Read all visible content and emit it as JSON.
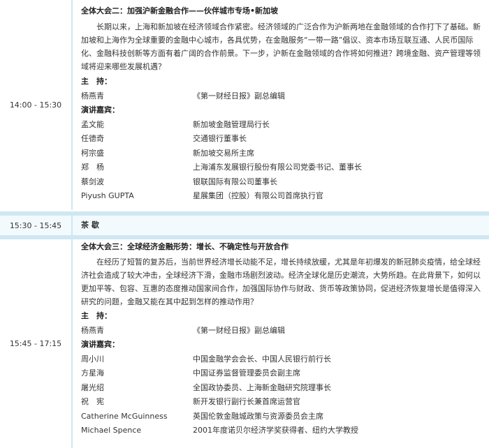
{
  "session2": {
    "time": "14:00 - 15:30",
    "title": "全体大会二：加强沪新金融合作——伙伴城市专场•新加坡",
    "intro": "长期以来，上海和新加坡在经济领域合作紧密。经济领域的广泛合作为沪新两地在金融领域的合作打下了基础。新加坡和上海作为全球重要的金融中心城市，各具优势，在金融服务“一带一路”倡议、资本市场互联互通、人民币国际化、金融科技创新等方面有着广阔的合作前景。下一步，沪新在金融领域的合作将如何推进？跨境金融、资产管理等领域将迎来哪些发展机遇？",
    "host_label": "主　持：",
    "host": {
      "name": "杨燕青",
      "role": "《第一财经日报》副总编辑"
    },
    "speakers_label": "演讲嘉宾：",
    "speakers": [
      {
        "name": "孟文能",
        "role": "新加坡金融管理局行长"
      },
      {
        "name": "任德奇",
        "role": "交通银行董事长"
      },
      {
        "name": "柯宗盛",
        "role": "新加坡交易所主席"
      },
      {
        "name": "郑　杨",
        "role": "上海浦东发展银行股份有限公司党委书记、董事长"
      },
      {
        "name": "蔡剑波",
        "role": "银联国际有限公司董事长"
      },
      {
        "name": "Piyush GUPTA",
        "role": "星展集团（控股）有限公司首席执行官"
      }
    ]
  },
  "break": {
    "time": "15:30 - 15:45",
    "label": "茶 歇"
  },
  "session3": {
    "time": "15:45 - 17:15",
    "title": "全体大会三：全球经济金融形势：增长、不确定性与开放合作",
    "intro": "在经历了短暂的复苏后，当前世界经济增长动能不足，增长持续放缓，尤其是年初爆发的新冠肺炎疫情，给全球经济社会造成了较大冲击，全球经济下滑，金融市场剧烈波动。经济全球化是历史潮流，大势所趋。在此背景下，如何以更加平等、包容、互惠的态度推动国家间合作，加强国际协作与财政、货币等政策协同，促进经济恢复增长是值得深入研究的问题，金融又能在其中起到怎样的推动作用？",
    "host_label": "主　持：",
    "host": {
      "name": "杨燕青",
      "role": "《第一财经日报》副总编辑"
    },
    "speakers_label": "演讲嘉宾：",
    "speakers": [
      {
        "name": "周小川",
        "role": "中国金融学会会长、中国人民银行前行长"
      },
      {
        "name": "方星海",
        "role": "中国证券监督管理委员会副主席"
      },
      {
        "name": "屠光绍",
        "role": "全国政协委员、上海新金融研究院理事长"
      },
      {
        "name": "祝　宪",
        "role": "新开发银行副行长兼首席运营官"
      },
      {
        "name": "Catherine McGuinness",
        "role": "英国伦敦金融城政策与资源委员会主席"
      },
      {
        "name": "Michael Spence",
        "role": "2001年度诺贝尔经济学奖获得者、纽约大学教授"
      }
    ]
  }
}
